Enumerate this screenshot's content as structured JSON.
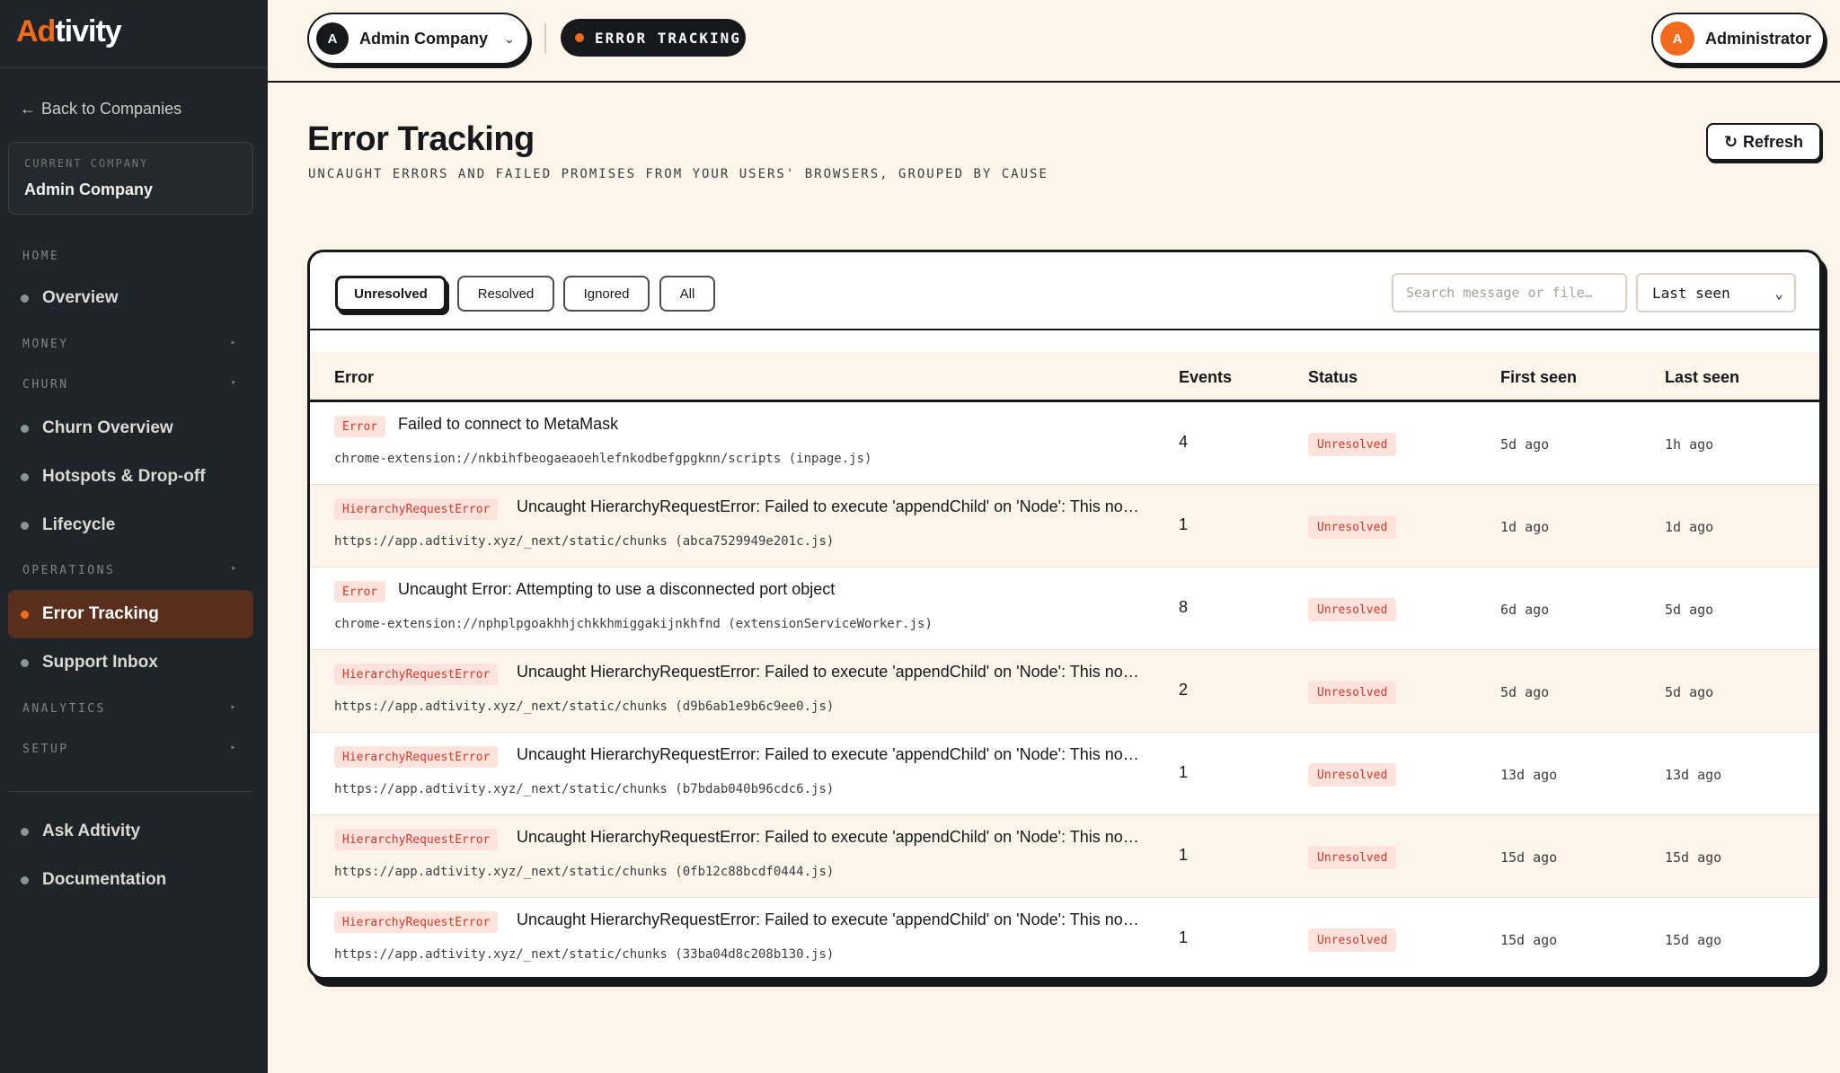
{
  "app": {
    "logo": "Adtivity"
  },
  "sidebar": {
    "back_label": "Back to Companies",
    "current_company_label": "CURRENT COMPANY",
    "current_company_name": "Admin Company",
    "sections": {
      "home": "HOME",
      "money": "MONEY",
      "churn": "CHURN",
      "operations": "OPERATIONS",
      "analytics": "ANALYTICS",
      "setup": "SETUP"
    },
    "items": {
      "overview": "Overview",
      "churn_overview": "Churn Overview",
      "hotspots": "Hotspots & Drop-off",
      "lifecycle": "Lifecycle",
      "error_tracking": "Error Tracking",
      "support_inbox": "Support Inbox",
      "ask": "Ask Adtivity",
      "docs": "Documentation"
    }
  },
  "topbar": {
    "company_initial": "A",
    "company_name": "Admin Company",
    "page_pill": "ERROR TRACKING",
    "user_initial": "A",
    "user_name": "Administrator"
  },
  "header": {
    "title": "Error Tracking",
    "subtitle": "UNCAUGHT ERRORS AND FAILED PROMISES FROM YOUR USERS' BROWSERS, GROUPED BY CAUSE",
    "refresh_label": "Refresh"
  },
  "filters": {
    "tabs": [
      "Unresolved",
      "Resolved",
      "Ignored",
      "All"
    ],
    "active": "Unresolved",
    "search_placeholder": "Search message or file…",
    "sort_value": "Last seen"
  },
  "table": {
    "columns": [
      "Error",
      "Events",
      "Status",
      "First seen",
      "Last seen"
    ],
    "rows": [
      {
        "type": "Error",
        "message": "Failed to connect to MetaMask",
        "source": "chrome-extension://nkbihfbeogaeaoehlefnkodbefgpgknn/scripts (inpage.js)",
        "events": "4",
        "status": "Unresolved",
        "first_seen": "5d ago",
        "last_seen": "1h ago"
      },
      {
        "type": "HierarchyRequestError",
        "message": "Uncaught HierarchyRequestError: Failed to execute 'appendChild' on 'Node': This node type does not support this method.",
        "source": "https://app.adtivity.xyz/_next/static/chunks (abca7529949e201c.js)",
        "events": "1",
        "status": "Unresolved",
        "first_seen": "1d ago",
        "last_seen": "1d ago"
      },
      {
        "type": "Error",
        "message": "Uncaught Error: Attempting to use a disconnected port object",
        "source": "chrome-extension://nphplpgoakhhjchkkhmiggakijnkhfnd (extensionServiceWorker.js)",
        "events": "8",
        "status": "Unresolved",
        "first_seen": "6d ago",
        "last_seen": "5d ago"
      },
      {
        "type": "HierarchyRequestError",
        "message": "Uncaught HierarchyRequestError: Failed to execute 'appendChild' on 'Node': This node type does not support this method.",
        "source": "https://app.adtivity.xyz/_next/static/chunks (d9b6ab1e9b6c9ee0.js)",
        "events": "2",
        "status": "Unresolved",
        "first_seen": "5d ago",
        "last_seen": "5d ago"
      },
      {
        "type": "HierarchyRequestError",
        "message": "Uncaught HierarchyRequestError: Failed to execute 'appendChild' on 'Node': This node type does not support this method.",
        "source": "https://app.adtivity.xyz/_next/static/chunks (b7bdab040b96cdc6.js)",
        "events": "1",
        "status": "Unresolved",
        "first_seen": "13d ago",
        "last_seen": "13d ago"
      },
      {
        "type": "HierarchyRequestError",
        "message": "Uncaught HierarchyRequestError: Failed to execute 'appendChild' on 'Node': This node type does not support this method.",
        "source": "https://app.adtivity.xyz/_next/static/chunks (0fb12c88bcdf0444.js)",
        "events": "1",
        "status": "Unresolved",
        "first_seen": "15d ago",
        "last_seen": "15d ago"
      },
      {
        "type": "HierarchyRequestError",
        "message": "Uncaught HierarchyRequestError: Failed to execute 'appendChild' on 'Node': This node type does not support this method.",
        "source": "https://app.adtivity.xyz/_next/static/chunks (33ba04d8c208b130.js)",
        "events": "1",
        "status": "Unresolved",
        "first_seen": "15d ago",
        "last_seen": "15d ago"
      }
    ]
  },
  "colors": {
    "accent": "#f26a1b",
    "sidebar_bg": "#1e2428",
    "page_bg": "#fdf4ea",
    "error_red": "#d2382a"
  }
}
